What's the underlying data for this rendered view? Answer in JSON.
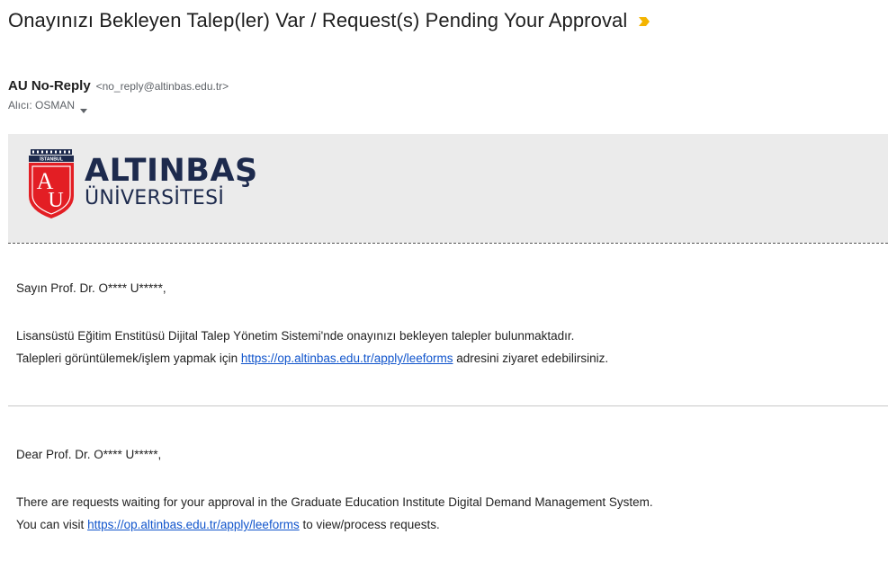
{
  "email": {
    "subject": "Onayınızı Bekleyen Talep(ler) Var / Request(s) Pending Your Approval",
    "importance_icon": "importance-marker-icon",
    "importance_color": "#f4b400",
    "sender": {
      "name": "AU No-Reply",
      "email": "<no_reply@altinbas.edu.tr>"
    },
    "recipient": {
      "label": "Alıcı: OSMAN",
      "icon": "chevron-down-icon"
    }
  },
  "banner": {
    "logo": {
      "badge_text": "İSTANBUL",
      "monogram": "AU",
      "title": "ALTINBAŞ",
      "subtitle": "ÜNİVERSİTESİ",
      "shield_color": "#e31e24",
      "text_color": "#1d2a4d"
    },
    "background": "#ebebeb"
  },
  "message": {
    "turkish": {
      "greeting": "Sayın Prof. Dr. O**** U*****,",
      "line1": "Lisansüstü Eğitim Enstitüsü Dijital Talep Yönetim Sistemi'nde onayınızı bekleyen talepler bulunmaktadır.",
      "line2_prefix": "Talepleri görüntülemek/işlem yapmak için ",
      "link": "https://op.altinbas.edu.tr/apply/leeforms",
      "line2_suffix": " adresini ziyaret edebilirsiniz."
    },
    "english": {
      "greeting": "Dear Prof. Dr. O**** U*****,",
      "line1": "There are requests waiting for your approval in the Graduate Education Institute Digital Demand Management System.",
      "line2_prefix": "You can visit ",
      "link": "https://op.altinbas.edu.tr/apply/leeforms",
      "line2_suffix": " to view/process requests."
    },
    "link_color": "#1155cc"
  }
}
